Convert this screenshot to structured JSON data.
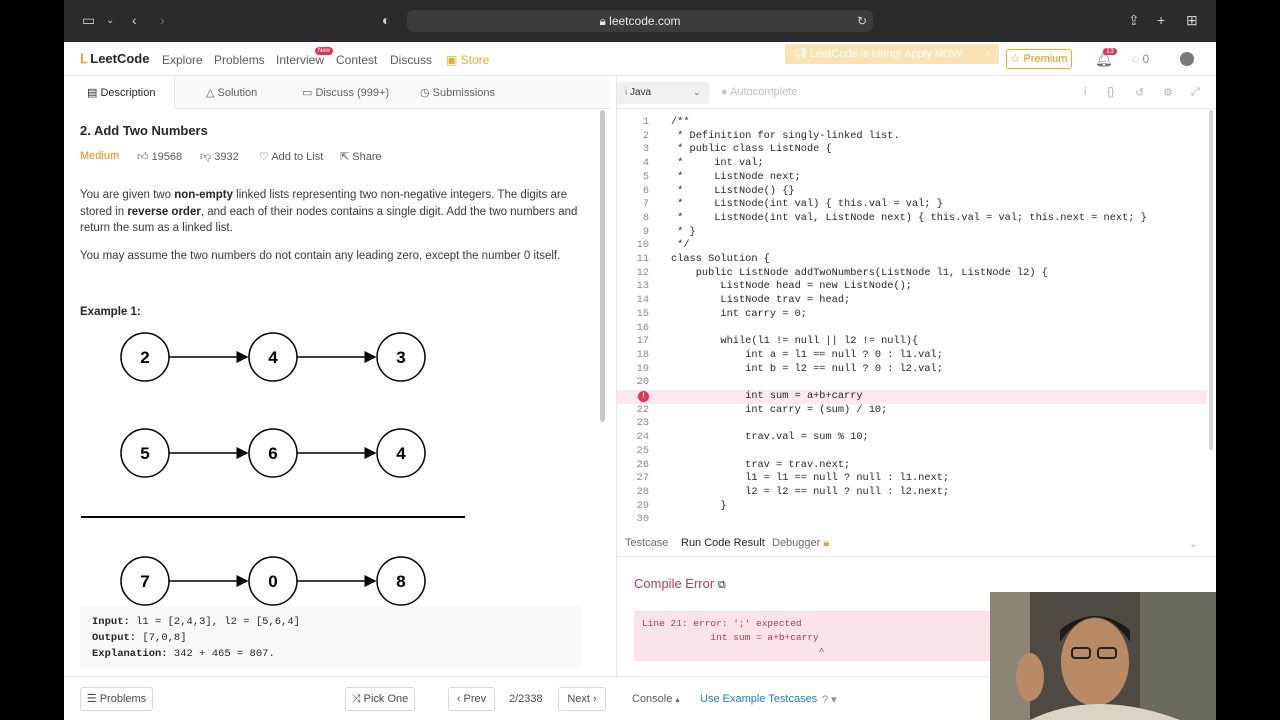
{
  "browser": {
    "url": "leetcode.com",
    "lock_icon": "lock-icon"
  },
  "nav": {
    "logo": "LeetCode",
    "items": [
      "Explore",
      "Problems",
      "Interview",
      "Contest",
      "Discuss"
    ],
    "store": "Store",
    "new_badge": "New",
    "hiring": "LeetCode is hiring! Apply NOW.",
    "premium": "Premium",
    "notif_count": "13",
    "streak": "0"
  },
  "tabs": [
    "Description",
    "Solution",
    "Discuss (999+)",
    "Submissions"
  ],
  "problem": {
    "title": "2. Add Two Numbers",
    "difficulty": "Medium",
    "likes": "19568",
    "dislikes": "3932",
    "add_to_list": "Add to List",
    "share": "Share",
    "desc_1a": "You are given two ",
    "desc_1b": "non-empty",
    "desc_1c": " linked lists representing two non-negative integers. The digits are stored in ",
    "desc_1d": "reverse order",
    "desc_1e": ", and each of their nodes contains a single digit. Add the two numbers and return the sum as a linked list.",
    "desc_2": "You may assume the two numbers do not contain any leading zero, except the number 0 itself.",
    "example_label": "Example 1:",
    "diagram": {
      "row1": [
        "2",
        "4",
        "3"
      ],
      "row2": [
        "5",
        "6",
        "4"
      ],
      "row3": [
        "7",
        "0",
        "8"
      ]
    },
    "input_label": "Input:",
    "input": " l1 = [2,4,3], l2 = [5,6,4]",
    "output_label": "Output:",
    "output": " [7,0,8]",
    "explanation_label": "Explanation:",
    "explanation": " 342 + 465 = 807."
  },
  "editor": {
    "language": "Java",
    "autocomplete": "Autocomplete",
    "lines": [
      {
        "n": "1",
        "t": "/**"
      },
      {
        "n": "2",
        "t": " * Definition for singly-linked list."
      },
      {
        "n": "3",
        "t": " * public class ListNode {"
      },
      {
        "n": "4",
        "t": " *     int val;"
      },
      {
        "n": "5",
        "t": " *     ListNode next;"
      },
      {
        "n": "6",
        "t": " *     ListNode() {}"
      },
      {
        "n": "7",
        "t": " *     ListNode(int val) { this.val = val; }"
      },
      {
        "n": "8",
        "t": " *     ListNode(int val, ListNode next) { this.val = val; this.next = next; }"
      },
      {
        "n": "9",
        "t": " * }"
      },
      {
        "n": "10",
        "t": " */"
      },
      {
        "n": "11",
        "t": "class Solution {"
      },
      {
        "n": "12",
        "t": "    public ListNode addTwoNumbers(ListNode l1, ListNode l2) {"
      },
      {
        "n": "13",
        "t": "        ListNode head = new ListNode();"
      },
      {
        "n": "14",
        "t": "        ListNode trav = head;"
      },
      {
        "n": "15",
        "t": "        int carry = 0;"
      },
      {
        "n": "16",
        "t": ""
      },
      {
        "n": "17",
        "t": "        while(l1 != null || l2 != null){"
      },
      {
        "n": "18",
        "t": "            int a = l1 == null ? 0 : l1.val;"
      },
      {
        "n": "19",
        "t": "            int b = l2 == null ? 0 : l2.val;"
      },
      {
        "n": "20",
        "t": ""
      },
      {
        "n": "",
        "t": "            int sum = a+b+carry"
      },
      {
        "n": "22",
        "t": "            int carry = (sum) / 10;"
      },
      {
        "n": "23",
        "t": ""
      },
      {
        "n": "24",
        "t": "            trav.val = sum % 10;"
      },
      {
        "n": "25",
        "t": ""
      },
      {
        "n": "26",
        "t": "            trav = trav.next;"
      },
      {
        "n": "27",
        "t": "            l1 = l1 == null ? null : l1.next;"
      },
      {
        "n": "28",
        "t": "            l2 = l2 == null ? null : l2.next;"
      },
      {
        "n": "29",
        "t": "        }"
      },
      {
        "n": "30",
        "t": ""
      }
    ],
    "error_marker": "!"
  },
  "result_tabs": [
    "Testcase",
    "Run Code Result",
    "Debugger"
  ],
  "result": {
    "title": "Compile Error",
    "line1": "Line 21: error: ';' expected",
    "line2": "            int sum = a+b+carry",
    "line3": "                               ^"
  },
  "bottom": {
    "problems": "Problems",
    "pick_one": "Pick One",
    "prev": "Prev",
    "page": "2/2338",
    "next": "Next",
    "console": "Console",
    "use_example": "Use Example Testcases"
  }
}
